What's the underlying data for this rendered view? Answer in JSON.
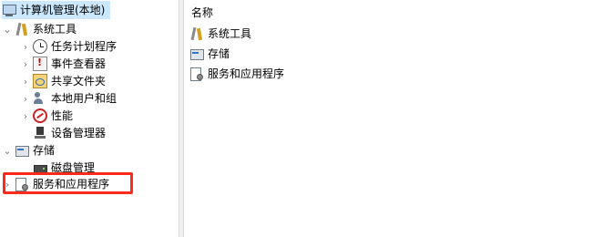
{
  "tree": {
    "root": {
      "label": "计算机管理(本地)",
      "icon": "computer-management-icon"
    },
    "items": [
      {
        "label": "系统工具",
        "icon": "system-tools-icon",
        "expander": "⌄"
      },
      {
        "label": "任务计划程序",
        "icon": "task-scheduler-icon",
        "expander": "›"
      },
      {
        "label": "事件查看器",
        "icon": "event-viewer-icon",
        "expander": "›"
      },
      {
        "label": "共享文件夹",
        "icon": "shared-folders-icon",
        "expander": "›"
      },
      {
        "label": "本地用户和组",
        "icon": "local-users-groups-icon",
        "expander": "›"
      },
      {
        "label": "性能",
        "icon": "performance-icon",
        "expander": "›"
      },
      {
        "label": "设备管理器",
        "icon": "device-manager-icon",
        "expander": ""
      },
      {
        "label": "存储",
        "icon": "storage-icon",
        "expander": "⌄"
      },
      {
        "label": "磁盘管理",
        "icon": "disk-management-icon",
        "expander": ""
      },
      {
        "label": "服务和应用程序",
        "icon": "services-applications-icon",
        "expander": "›"
      }
    ]
  },
  "list": {
    "column_header": "名称",
    "items": [
      {
        "label": "系统工具",
        "icon": "system-tools-icon"
      },
      {
        "label": "存储",
        "icon": "storage-icon"
      },
      {
        "label": "服务和应用程序",
        "icon": "services-applications-icon"
      }
    ]
  },
  "colors": {
    "selection": "#cce8ff",
    "highlight_box": "#ff2a1a"
  }
}
